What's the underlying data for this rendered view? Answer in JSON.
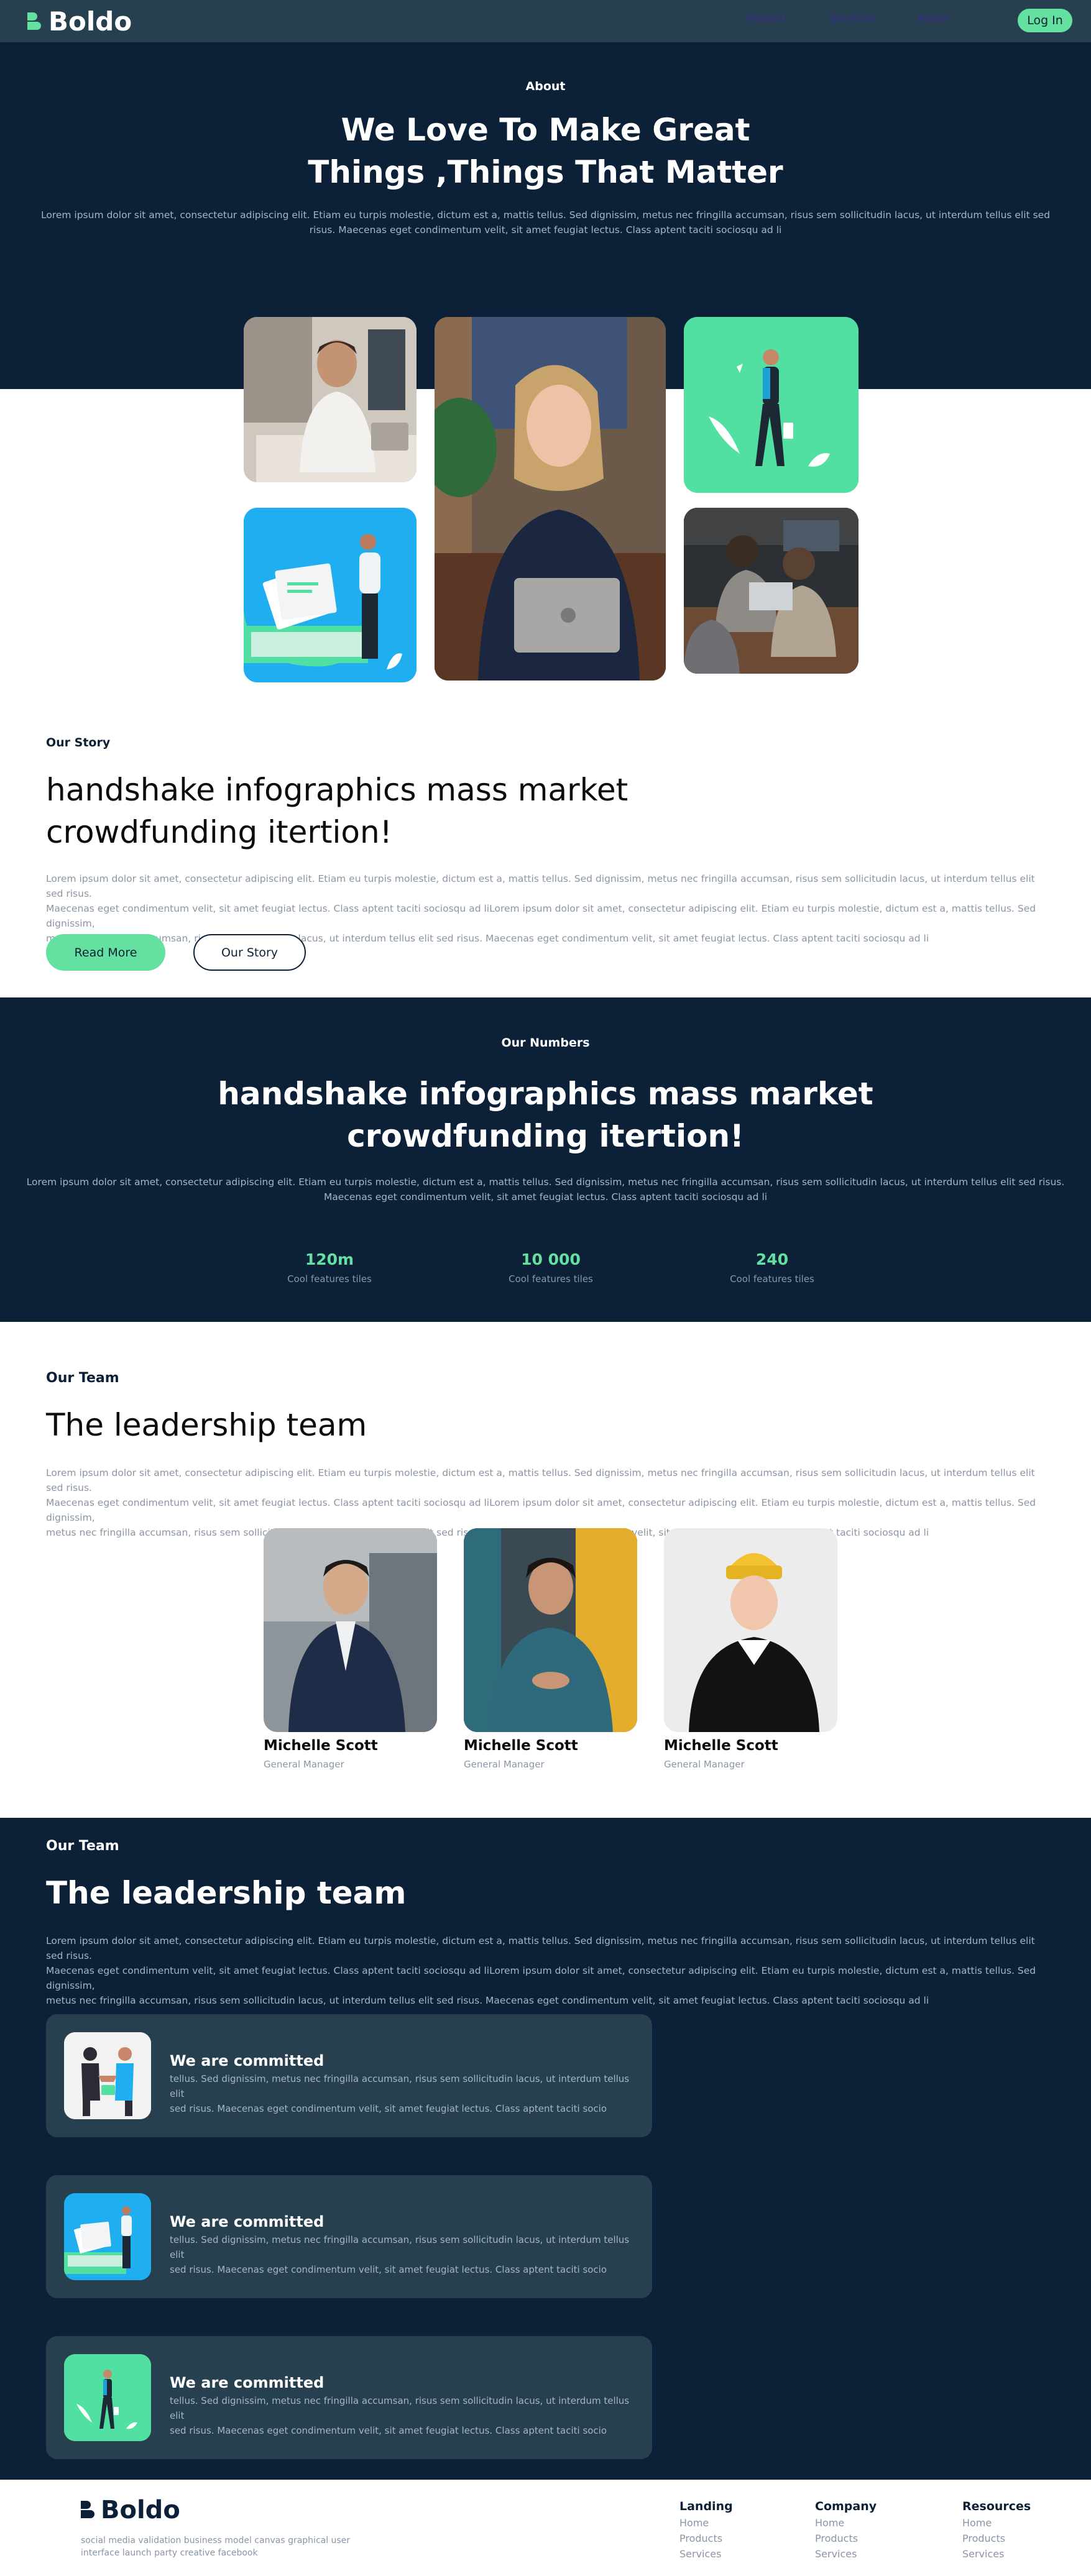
{
  "header": {
    "brand": "Boldo",
    "nav": [
      "Product",
      "Services",
      "About"
    ],
    "login_label": "Log In"
  },
  "hero": {
    "eyebrow": "About",
    "title_line1": "We Love To Make Great",
    "title_line2": "Things ,Things That Matter",
    "paragraph_line1": "Lorem ipsum dolor sit amet, consectetur adipiscing elit. Etiam eu turpis molestie, dictum est a, mattis tellus. Sed dignissim, metus nec fringilla accumsan, risus sem sollicitudin lacus, ut interdum tellus elit sed",
    "paragraph_line2": "risus. Maecenas eget condimentum velit, sit amet feugiat lectus. Class aptent taciti sociosqu ad li"
  },
  "story": {
    "eyebrow": "Our Story",
    "title_line1": "handshake infographics mass market",
    "title_line2": "crowdfunding itertion!",
    "paragraph_lines": [
      "Lorem ipsum dolor sit amet, consectetur adipiscing elit. Etiam eu turpis molestie, dictum est a, mattis tellus. Sed dignissim, metus nec fringilla accumsan, risus sem sollicitudin lacus, ut interdum tellus elit sed risus.",
      "Maecenas eget condimentum velit, sit amet feugiat lectus. Class aptent taciti sociosqu ad liLorem ipsum dolor sit amet, consectetur adipiscing elit. Etiam eu turpis molestie, dictum est a, mattis tellus. Sed dignissim,",
      "metus nec fringilla accumsan, risus sem sollicitudin lacus, ut interdum tellus elit sed risus. Maecenas eget condimentum velit, sit amet feugiat lectus. Class aptent taciti sociosqu ad li"
    ],
    "read_more_label": "Read More",
    "our_story_label": "Our Story"
  },
  "numbers": {
    "eyebrow": "Our Numbers",
    "title_line1": "handshake infographics mass market",
    "title_line2": "crowdfunding itertion!",
    "paragraph_line1": "Lorem ipsum dolor sit amet, consectetur adipiscing elit. Etiam eu turpis molestie, dictum est a, mattis tellus. Sed dignissim, metus nec fringilla accumsan, risus sem sollicitudin lacus, ut interdum tellus elit sed risus.",
    "paragraph_line2": "Maecenas eget condimentum velit, sit amet feugiat lectus. Class aptent taciti sociosqu ad li",
    "stats": [
      {
        "value": "120m",
        "label": "Cool features tiles"
      },
      {
        "value": "10 000",
        "label": "Cool features tiles"
      },
      {
        "value": "240",
        "label": "Cool features tiles"
      }
    ]
  },
  "team": {
    "eyebrow": "Our Team",
    "title": "The leadership team",
    "paragraph_lines": [
      "Lorem ipsum dolor sit amet, consectetur adipiscing elit. Etiam eu turpis molestie, dictum est a, mattis tellus. Sed dignissim, metus nec fringilla accumsan, risus sem sollicitudin lacus, ut interdum tellus elit sed risus.",
      "Maecenas eget condimentum velit, sit amet feugiat lectus. Class aptent taciti sociosqu ad liLorem ipsum dolor sit amet, consectetur adipiscing elit. Etiam eu turpis molestie, dictum est a, mattis tellus. Sed dignissim,",
      "metus nec fringilla accumsan, risus sem sollicitudin lacus, ut interdum tellus elit sed risus. Maecenas eget condimentum velit, sit amet feugiat lectus. Class aptent taciti sociosqu ad li"
    ],
    "members": [
      {
        "name": "Michelle Scott",
        "role": "General Manager"
      },
      {
        "name": "Michelle Scott",
        "role": "General Manager"
      },
      {
        "name": "Michelle Scott",
        "role": "General Manager"
      }
    ]
  },
  "team2": {
    "eyebrow": "Our Team",
    "title": "The leadership team",
    "paragraph_lines": [
      "Lorem ipsum dolor sit amet, consectetur adipiscing elit. Etiam eu turpis molestie, dictum est a, mattis tellus. Sed dignissim, metus nec fringilla accumsan, risus sem sollicitudin lacus, ut interdum tellus elit sed risus.",
      "Maecenas eget condimentum velit, sit amet feugiat lectus. Class aptent taciti sociosqu ad liLorem ipsum dolor sit amet, consectetur adipiscing elit. Etiam eu turpis molestie, dictum est a, mattis tellus. Sed dignissim,",
      "metus nec fringilla accumsan, risus sem sollicitudin lacus, ut interdum tellus elit sed risus. Maecenas eget condimentum velit, sit amet feugiat lectus. Class aptent taciti sociosqu ad li"
    ],
    "cards": [
      {
        "title": "We are committed",
        "text_line1": "tellus. Sed dignissim, metus nec fringilla accumsan, risus sem sollicitudin lacus, ut interdum tellus elit",
        "text_line2": "sed risus. Maecenas eget condimentum velit, sit amet feugiat lectus. Class aptent taciti socio"
      },
      {
        "title": "We are committed",
        "text_line1": "tellus. Sed dignissim, metus nec fringilla accumsan, risus sem sollicitudin lacus, ut interdum tellus elit",
        "text_line2": "sed risus. Maecenas eget condimentum velit, sit amet feugiat lectus. Class aptent taciti socio"
      },
      {
        "title": "We are committed",
        "text_line1": "tellus. Sed dignissim, metus nec fringilla accumsan, risus sem sollicitudin lacus, ut interdum tellus elit",
        "text_line2": "sed risus. Maecenas eget condimentum velit, sit amet feugiat lectus. Class aptent taciti socio"
      }
    ]
  },
  "footer": {
    "brand": "Boldo",
    "tagline_line1": "social media validation business model canvas graphical user",
    "tagline_line2": "interface launch party creative facebook",
    "columns": [
      {
        "heading": "Landing",
        "links": [
          "Home",
          "Products",
          "Services"
        ]
      },
      {
        "heading": "Company",
        "links": [
          "Home",
          "Products",
          "Services"
        ]
      },
      {
        "heading": "Resources",
        "links": [
          "Home",
          "Products",
          "Services"
        ]
      }
    ]
  },
  "colors": {
    "navy": "#0c2137",
    "slate": "#26404f",
    "accent": "#64e0a0"
  }
}
